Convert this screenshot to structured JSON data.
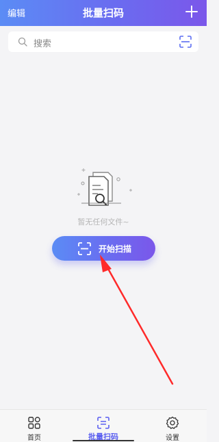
{
  "header": {
    "edit_label": "编辑",
    "title": "批量扫码",
    "add_icon": "plus-icon"
  },
  "search": {
    "placeholder": "搜索",
    "search_icon": "search-icon",
    "scan_icon": "scan-icon"
  },
  "empty_state": {
    "message": "暂无任何文件~",
    "illustration": "empty-document-search-illustration"
  },
  "start_scan_button": {
    "label": "开始扫描",
    "icon": "scan-icon"
  },
  "tabbar": {
    "tabs": [
      {
        "label": "首页",
        "icon": "grid-icon",
        "active": false
      },
      {
        "label": "批量扫码",
        "icon": "scan-icon",
        "active": true
      },
      {
        "label": "设置",
        "icon": "gear-icon",
        "active": false
      }
    ]
  },
  "colors": {
    "accent_start": "#5b8cf5",
    "accent_end": "#7b57ea",
    "arrow": "#ff2a2a",
    "background": "#f4f4f6"
  }
}
